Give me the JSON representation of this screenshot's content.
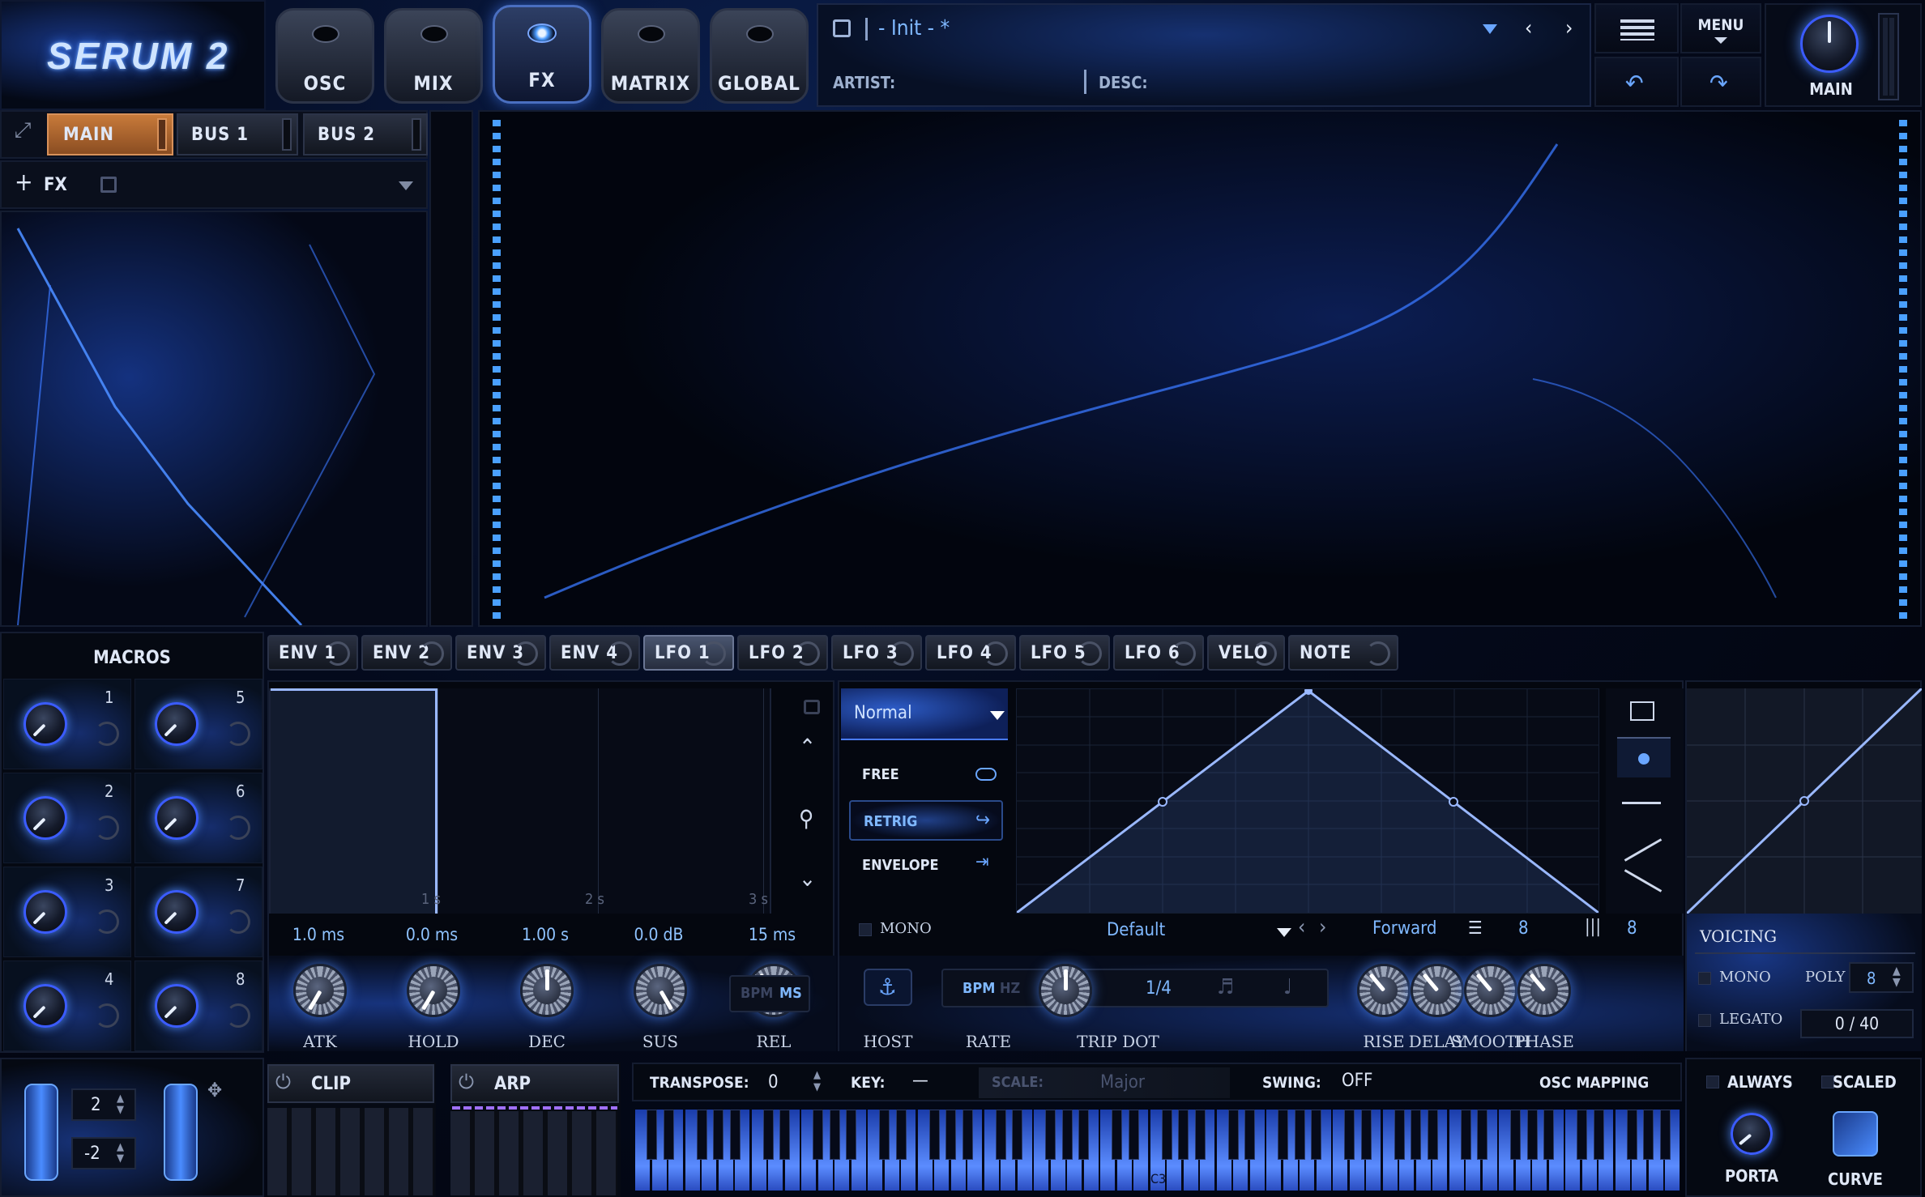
{
  "app": {
    "logo": "SERUM 2"
  },
  "top_nav": {
    "tabs": [
      {
        "label": "OSC"
      },
      {
        "label": "MIX"
      },
      {
        "label": "FX",
        "active": true
      },
      {
        "label": "MATRIX"
      },
      {
        "label": "GLOBAL"
      }
    ]
  },
  "preset": {
    "name": "- Init - *",
    "artist_label": "ARTIST:",
    "desc_label": "DESC:",
    "menu_label": "MENU",
    "main_knob_label": "MAIN"
  },
  "fx_panel": {
    "tabs": [
      {
        "label": "MAIN",
        "active": true
      },
      {
        "label": "BUS 1"
      },
      {
        "label": "BUS 2"
      }
    ],
    "add_fx_label": "FX"
  },
  "macros": {
    "title": "MACROS",
    "items": [
      {
        "num": "1"
      },
      {
        "num": "5"
      },
      {
        "num": "2"
      },
      {
        "num": "6"
      },
      {
        "num": "3"
      },
      {
        "num": "7"
      },
      {
        "num": "4"
      },
      {
        "num": "8"
      }
    ]
  },
  "mod_tabs": [
    {
      "label": "ENV 1"
    },
    {
      "label": "ENV 2"
    },
    {
      "label": "ENV 3"
    },
    {
      "label": "ENV 4"
    },
    {
      "label": "LFO 1",
      "active": true
    },
    {
      "label": "LFO 2"
    },
    {
      "label": "LFO 3"
    },
    {
      "label": "LFO 4"
    },
    {
      "label": "LFO 5"
    },
    {
      "label": "LFO 6"
    },
    {
      "label": "VELO"
    },
    {
      "label": "NOTE"
    }
  ],
  "envelope": {
    "time_marks": [
      "1 s",
      "2 s",
      "3 s"
    ],
    "values": [
      "1.0 ms",
      "0.0 ms",
      "1.00 s",
      "0.0 dB",
      "15 ms"
    ],
    "knobs": [
      "ATK",
      "HOLD",
      "DEC",
      "SUS",
      "REL"
    ],
    "bpm_label": "BPM",
    "ms_label": "MS"
  },
  "lfo": {
    "mode": "Normal",
    "trigger_modes": [
      "FREE",
      "RETRIG",
      "ENVELOPE"
    ],
    "mono_label": "MONO",
    "shape_preset": "Default",
    "direction": "Forward",
    "grid_x": "8",
    "grid_y": "8",
    "host_label": "HOST",
    "rate_bpm": "BPM",
    "rate_hz": "HZ",
    "rate_value": "1/4",
    "knob_labels": [
      "RATE",
      "TRIP",
      "DOT",
      "RISE",
      "DELAY",
      "SMOOTH",
      "PHASE"
    ]
  },
  "voicing": {
    "title": "VOICING",
    "mono_label": "MONO",
    "poly_label": "POLY",
    "poly_value": "8",
    "legato_label": "LEGATO",
    "voices": "0 / 40"
  },
  "bottom": {
    "pitch_up": "2",
    "pitch_down": "-2",
    "clip_label": "CLIP",
    "arp_label": "ARP",
    "transpose_label": "TRANSPOSE:",
    "transpose_value": "0",
    "key_label": "KEY:",
    "key_value": "—",
    "scale_label": "SCALE:",
    "scale_value": "Major",
    "swing_label": "SWING:",
    "swing_value": "OFF",
    "osc_mapping_label": "OSC MAPPING",
    "c3_label": "C3",
    "always_label": "ALWAYS",
    "scaled_label": "SCALED",
    "porta_label": "PORTA",
    "curve_label": "CURVE"
  },
  "colors": {
    "accent": "#4a9bff",
    "active_tab": "#b06a30",
    "background": "#03060f"
  }
}
